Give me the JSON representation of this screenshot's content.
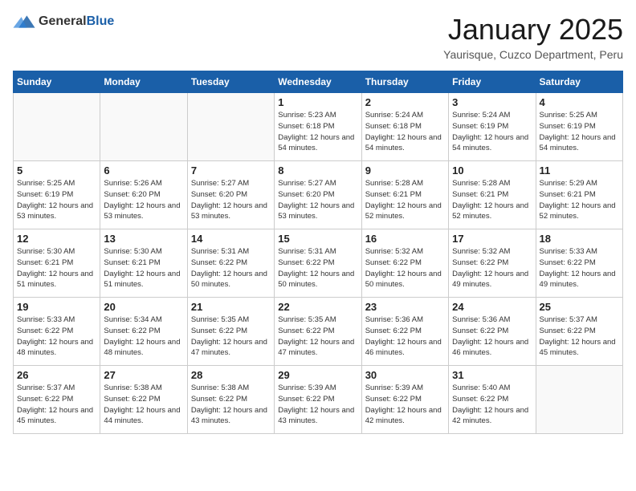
{
  "header": {
    "logo": {
      "general": "General",
      "blue": "Blue"
    },
    "title": "January 2025",
    "location": "Yaurisque, Cuzco Department, Peru"
  },
  "calendar": {
    "days_of_week": [
      "Sunday",
      "Monday",
      "Tuesday",
      "Wednesday",
      "Thursday",
      "Friday",
      "Saturday"
    ],
    "weeks": [
      [
        {
          "day": "",
          "empty": true
        },
        {
          "day": "",
          "empty": true
        },
        {
          "day": "",
          "empty": true
        },
        {
          "day": "1",
          "sunrise": "5:23 AM",
          "sunset": "6:18 PM",
          "daylight": "12 hours and 54 minutes."
        },
        {
          "day": "2",
          "sunrise": "5:24 AM",
          "sunset": "6:18 PM",
          "daylight": "12 hours and 54 minutes."
        },
        {
          "day": "3",
          "sunrise": "5:24 AM",
          "sunset": "6:19 PM",
          "daylight": "12 hours and 54 minutes."
        },
        {
          "day": "4",
          "sunrise": "5:25 AM",
          "sunset": "6:19 PM",
          "daylight": "12 hours and 54 minutes."
        }
      ],
      [
        {
          "day": "5",
          "sunrise": "5:25 AM",
          "sunset": "6:19 PM",
          "daylight": "12 hours and 53 minutes."
        },
        {
          "day": "6",
          "sunrise": "5:26 AM",
          "sunset": "6:20 PM",
          "daylight": "12 hours and 53 minutes."
        },
        {
          "day": "7",
          "sunrise": "5:27 AM",
          "sunset": "6:20 PM",
          "daylight": "12 hours and 53 minutes."
        },
        {
          "day": "8",
          "sunrise": "5:27 AM",
          "sunset": "6:20 PM",
          "daylight": "12 hours and 53 minutes."
        },
        {
          "day": "9",
          "sunrise": "5:28 AM",
          "sunset": "6:21 PM",
          "daylight": "12 hours and 52 minutes."
        },
        {
          "day": "10",
          "sunrise": "5:28 AM",
          "sunset": "6:21 PM",
          "daylight": "12 hours and 52 minutes."
        },
        {
          "day": "11",
          "sunrise": "5:29 AM",
          "sunset": "6:21 PM",
          "daylight": "12 hours and 52 minutes."
        }
      ],
      [
        {
          "day": "12",
          "sunrise": "5:30 AM",
          "sunset": "6:21 PM",
          "daylight": "12 hours and 51 minutes."
        },
        {
          "day": "13",
          "sunrise": "5:30 AM",
          "sunset": "6:21 PM",
          "daylight": "12 hours and 51 minutes."
        },
        {
          "day": "14",
          "sunrise": "5:31 AM",
          "sunset": "6:22 PM",
          "daylight": "12 hours and 50 minutes."
        },
        {
          "day": "15",
          "sunrise": "5:31 AM",
          "sunset": "6:22 PM",
          "daylight": "12 hours and 50 minutes."
        },
        {
          "day": "16",
          "sunrise": "5:32 AM",
          "sunset": "6:22 PM",
          "daylight": "12 hours and 50 minutes."
        },
        {
          "day": "17",
          "sunrise": "5:32 AM",
          "sunset": "6:22 PM",
          "daylight": "12 hours and 49 minutes."
        },
        {
          "day": "18",
          "sunrise": "5:33 AM",
          "sunset": "6:22 PM",
          "daylight": "12 hours and 49 minutes."
        }
      ],
      [
        {
          "day": "19",
          "sunrise": "5:33 AM",
          "sunset": "6:22 PM",
          "daylight": "12 hours and 48 minutes."
        },
        {
          "day": "20",
          "sunrise": "5:34 AM",
          "sunset": "6:22 PM",
          "daylight": "12 hours and 48 minutes."
        },
        {
          "day": "21",
          "sunrise": "5:35 AM",
          "sunset": "6:22 PM",
          "daylight": "12 hours and 47 minutes."
        },
        {
          "day": "22",
          "sunrise": "5:35 AM",
          "sunset": "6:22 PM",
          "daylight": "12 hours and 47 minutes."
        },
        {
          "day": "23",
          "sunrise": "5:36 AM",
          "sunset": "6:22 PM",
          "daylight": "12 hours and 46 minutes."
        },
        {
          "day": "24",
          "sunrise": "5:36 AM",
          "sunset": "6:22 PM",
          "daylight": "12 hours and 46 minutes."
        },
        {
          "day": "25",
          "sunrise": "5:37 AM",
          "sunset": "6:22 PM",
          "daylight": "12 hours and 45 minutes."
        }
      ],
      [
        {
          "day": "26",
          "sunrise": "5:37 AM",
          "sunset": "6:22 PM",
          "daylight": "12 hours and 45 minutes."
        },
        {
          "day": "27",
          "sunrise": "5:38 AM",
          "sunset": "6:22 PM",
          "daylight": "12 hours and 44 minutes."
        },
        {
          "day": "28",
          "sunrise": "5:38 AM",
          "sunset": "6:22 PM",
          "daylight": "12 hours and 43 minutes."
        },
        {
          "day": "29",
          "sunrise": "5:39 AM",
          "sunset": "6:22 PM",
          "daylight": "12 hours and 43 minutes."
        },
        {
          "day": "30",
          "sunrise": "5:39 AM",
          "sunset": "6:22 PM",
          "daylight": "12 hours and 42 minutes."
        },
        {
          "day": "31",
          "sunrise": "5:40 AM",
          "sunset": "6:22 PM",
          "daylight": "12 hours and 42 minutes."
        },
        {
          "day": "",
          "empty": true
        }
      ]
    ]
  }
}
